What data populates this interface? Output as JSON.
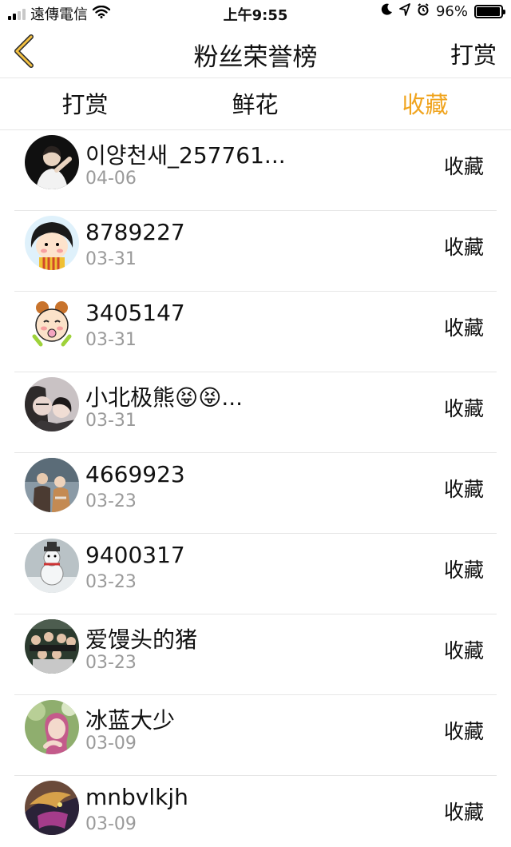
{
  "status_bar": {
    "carrier": "遠傳電信",
    "time": "上午9:55",
    "battery": "96%",
    "battery_level": 0.96
  },
  "nav": {
    "title": "粉丝荣誉榜",
    "right_label": "打赏",
    "back_icon": "chevron-left-icon",
    "accent_color": "#f0a41e"
  },
  "tabs": [
    {
      "label": "打赏",
      "active": false
    },
    {
      "label": "鲜花",
      "active": false
    },
    {
      "label": "收藏",
      "active": true
    }
  ],
  "list": [
    {
      "name": "이양천새_257761...",
      "date": "04-06",
      "action": "收藏"
    },
    {
      "name": "8789227",
      "date": "03-31",
      "action": "收藏"
    },
    {
      "name": "3405147",
      "date": "03-31",
      "action": "收藏"
    },
    {
      "name": "小北极熊😝😝...",
      "date": "03-31",
      "action": "收藏"
    },
    {
      "name": "4669923",
      "date": "03-23",
      "action": "收藏"
    },
    {
      "name": "9400317",
      "date": "03-23",
      "action": "收藏"
    },
    {
      "name": "爱馒头的猪",
      "date": "03-23",
      "action": "收藏"
    },
    {
      "name": "冰蓝大少",
      "date": "03-09",
      "action": "收藏"
    },
    {
      "name": "mnbvlkjh",
      "date": "03-09",
      "action": "收藏"
    }
  ]
}
